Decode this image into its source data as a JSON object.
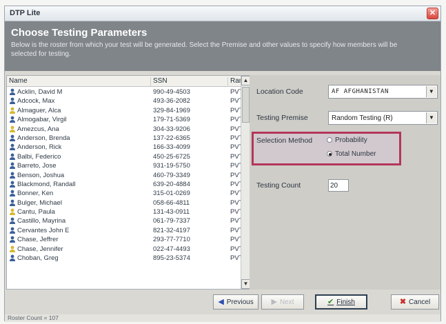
{
  "window": {
    "title": "DTP Lite",
    "close_glyph": "✕"
  },
  "header": {
    "title": "Choose Testing Parameters",
    "description": "Below is the roster from which your test will be generated.  Select the Premise and other values to specify how members will be selected for testing."
  },
  "roster": {
    "columns": {
      "name": "Name",
      "ssn": "SSN",
      "rank": "Rank"
    },
    "rows": [
      {
        "name": "Acklin, David M",
        "ssn": "990-49-4503",
        "rank": "PVT"
      },
      {
        "name": "Adcock, Max",
        "ssn": "493-36-2082",
        "rank": "PVT"
      },
      {
        "name": "Almaguer, Alca",
        "ssn": "329-84-1969",
        "rank": "PVT"
      },
      {
        "name": "Almogabar, Virgil",
        "ssn": "179-71-5369",
        "rank": "PVT"
      },
      {
        "name": "Amezcus, Ana",
        "ssn": "304-33-9206",
        "rank": "PVT"
      },
      {
        "name": "Anderson, Brenda",
        "ssn": "137-22-6365",
        "rank": "PVT"
      },
      {
        "name": "Anderson, Rick",
        "ssn": "166-33-4099",
        "rank": "PVT"
      },
      {
        "name": "Balbi, Federico",
        "ssn": "450-25-6725",
        "rank": "PVT"
      },
      {
        "name": "Barreto, Jose",
        "ssn": "931-19-5750",
        "rank": "PVT"
      },
      {
        "name": "Benson, Joshua",
        "ssn": "460-79-3349",
        "rank": "PVT"
      },
      {
        "name": "Blackmond, Randall",
        "ssn": "639-20-4884",
        "rank": "PVT"
      },
      {
        "name": "Bonner, Ken",
        "ssn": "315-01-0269",
        "rank": "PVT"
      },
      {
        "name": "Bulger, Michael",
        "ssn": "058-66-4811",
        "rank": "PVT"
      },
      {
        "name": "Cantu, Paula",
        "ssn": "131-43-0911",
        "rank": "PVT"
      },
      {
        "name": "Castillo, Mayrina",
        "ssn": "061-79-7337",
        "rank": "PVT"
      },
      {
        "name": "Cervantes John E",
        "ssn": "821-32-4197",
        "rank": "PVT"
      },
      {
        "name": "Chase, Jeffrer",
        "ssn": "293-77-7710",
        "rank": "PVT"
      },
      {
        "name": "Chase, Jennifer",
        "ssn": "022-47-4493",
        "rank": "PVT"
      },
      {
        "name": "Choban, Greg",
        "ssn": "895-23-5374",
        "rank": "PVT"
      }
    ],
    "row_icon": "person-icon",
    "icon_colors": {
      "person_blue": "#3b5f9a",
      "person_yellow": "#d6b930"
    }
  },
  "params": {
    "location_code": {
      "label": "Location Code",
      "value": "AF AFGHANISTAN"
    },
    "testing_premise": {
      "label": "Testing Premise",
      "value": "Random Testing (R)"
    },
    "selection_method": {
      "label": "Selection Method",
      "options": [
        {
          "label": "Probability",
          "checked": false
        },
        {
          "label": "Total Number",
          "checked": true
        }
      ]
    },
    "testing_count": {
      "label": "Testing Count",
      "value": "20"
    }
  },
  "buttons": {
    "previous": "Previous",
    "next": "Next",
    "finish": "Finish",
    "cancel": "Cancel"
  },
  "status": {
    "text": "Roster Count = 107"
  },
  "colors": {
    "header_bg": "#808589",
    "highlight_border": "#b3365a",
    "cancel_x": "#c8302b",
    "finish_check": "#2f8a2a",
    "previous_arrow": "#2d4fb0"
  }
}
